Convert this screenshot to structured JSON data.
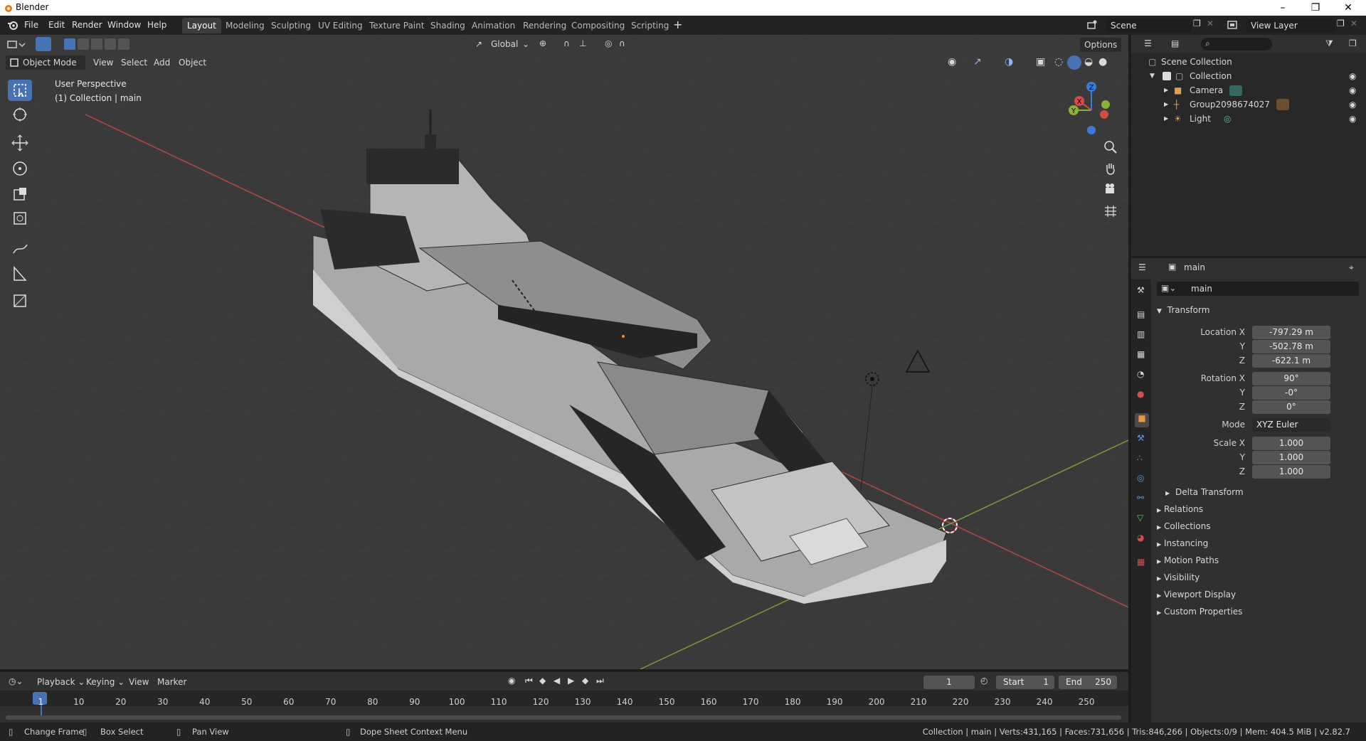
{
  "window": {
    "title": "Blender"
  },
  "menu": [
    "File",
    "Edit",
    "Render",
    "Window",
    "Help"
  ],
  "workspaces": [
    "Layout",
    "Modeling",
    "Sculpting",
    "UV Editing",
    "Texture Paint",
    "Shading",
    "Animation",
    "Rendering",
    "Compositing",
    "Scripting"
  ],
  "active_workspace": "Layout",
  "scene": {
    "name": "Scene",
    "view_layer": "View Layer"
  },
  "viewport": {
    "transform_orientation": "Global",
    "options_label": "Options",
    "mode": "Object Mode",
    "header_menus": [
      "View",
      "Select",
      "Add",
      "Object"
    ],
    "perspective_label": "User Perspective",
    "context_label": "(1) Collection | main",
    "gizmo_axes": [
      "X",
      "Y",
      "Z"
    ]
  },
  "outliner": {
    "root": "Scene Collection",
    "collection": "Collection",
    "items": [
      "Camera",
      "Group2098674027",
      "Light"
    ]
  },
  "properties": {
    "header_object": "main",
    "object_name": "main",
    "transform_label": "Transform",
    "location_label": "Location X",
    "rotation_label": "Rotation X",
    "scale_label": "Scale X",
    "y_label": "Y",
    "z_label": "Z",
    "mode_label": "Mode",
    "location": [
      "-797.29 m",
      "-502.78 m",
      "-622.1 m"
    ],
    "rotation": [
      "90°",
      "-0°",
      "0°"
    ],
    "rotation_mode": "XYZ Euler",
    "scale": [
      "1.000",
      "1.000",
      "1.000"
    ],
    "delta_transform": "Delta Transform",
    "panels": [
      "Relations",
      "Collections",
      "Instancing",
      "Motion Paths",
      "Visibility",
      "Viewport Display",
      "Custom Properties"
    ]
  },
  "timeline": {
    "menus": [
      "Playback",
      "Keying",
      "View",
      "Marker"
    ],
    "current_frame": "1",
    "start_label": "Start",
    "start": "1",
    "end_label": "End",
    "end": "250",
    "ruler": [
      "1",
      "10",
      "20",
      "30",
      "40",
      "50",
      "60",
      "70",
      "80",
      "90",
      "100",
      "110",
      "120",
      "130",
      "140",
      "150",
      "160",
      "170",
      "180",
      "190",
      "200",
      "210",
      "220",
      "230",
      "240",
      "250"
    ]
  },
  "statusbar": {
    "left": [
      "Change Frame",
      "Box Select",
      "Pan View",
      "Dope Sheet Context Menu"
    ],
    "stats": "Collection | main | Verts:431,165 | Faces:731,656 | Tris:846,266 | Objects:0/9 | Mem: 404.5 MiB | v2.82.7"
  },
  "colors": {
    "accent": "#4772b3",
    "x_axis": "#d64a4a",
    "y_axis": "#8ab23a",
    "z_axis": "#3d7bd9"
  }
}
